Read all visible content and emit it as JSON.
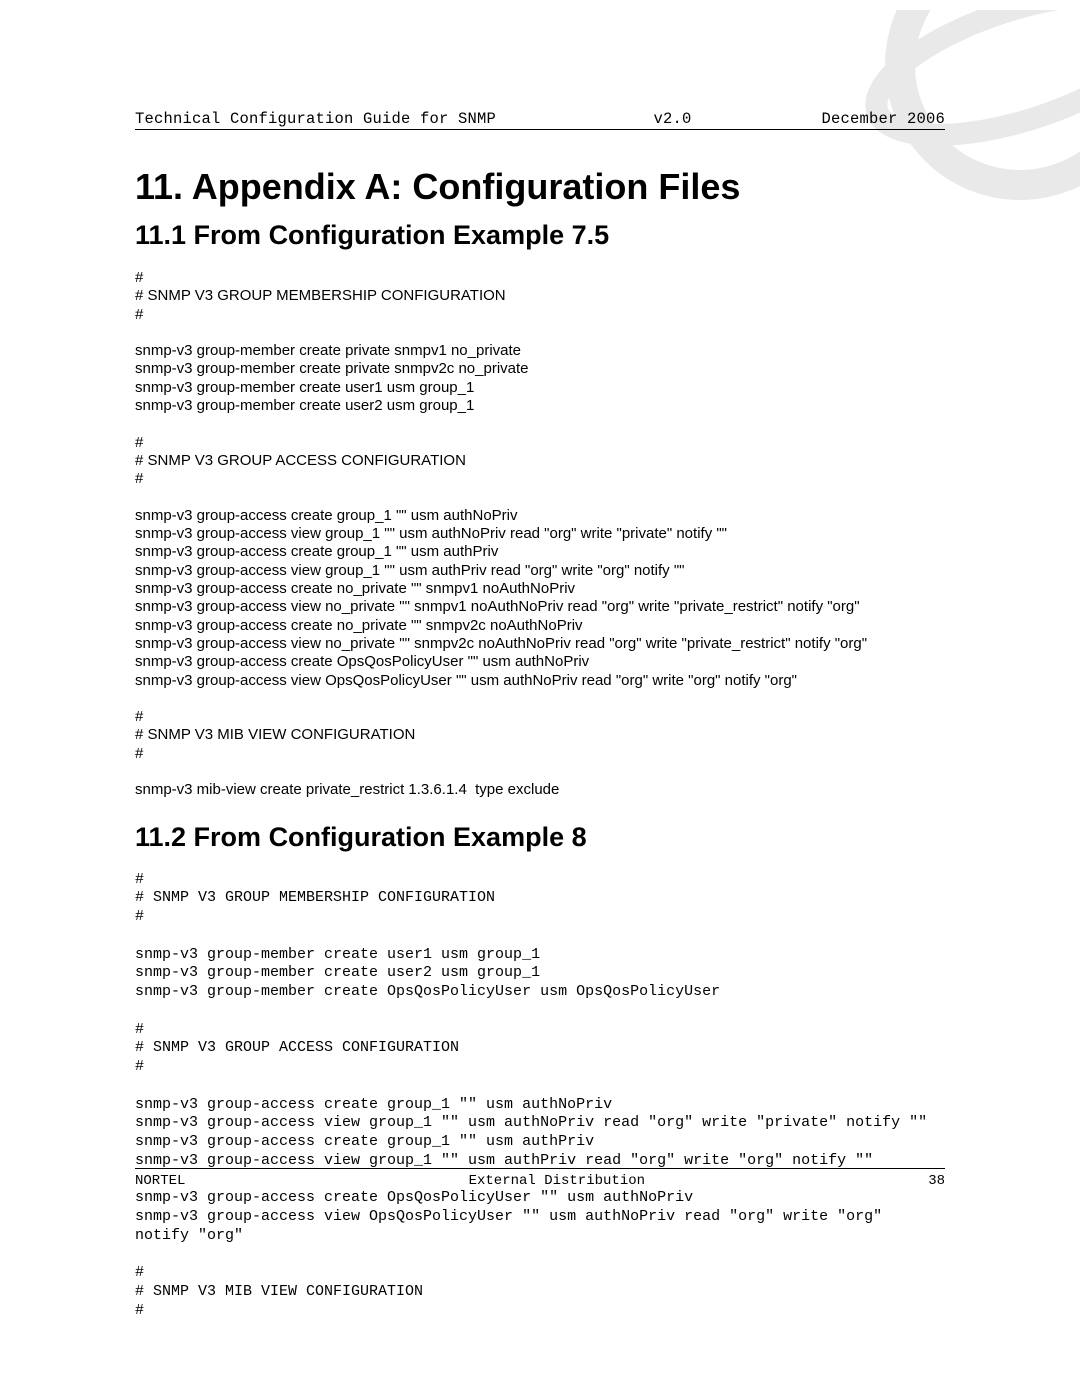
{
  "header": {
    "title_left": "Technical Configuration Guide for SNMP",
    "version": "v2.0",
    "date": "December 2006"
  },
  "h1": "11.  Appendix A: Configuration Files",
  "sec1": {
    "title": "11.1 From Configuration Example 7.5",
    "para1": "#\n# SNMP V3 GROUP MEMBERSHIP CONFIGURATION\n#\n\nsnmp-v3 group-member create private snmpv1 no_private\nsnmp-v3 group-member create private snmpv2c no_private\nsnmp-v3 group-member create user1 usm group_1\nsnmp-v3 group-member create user2 usm group_1\n\n#\n# SNMP V3 GROUP ACCESS CONFIGURATION\n#\n\nsnmp-v3 group-access create group_1 \"\" usm authNoPriv\nsnmp-v3 group-access view group_1 \"\" usm authNoPriv read \"org\" write \"private\" notify \"\"\nsnmp-v3 group-access create group_1 \"\" usm authPriv\nsnmp-v3 group-access view group_1 \"\" usm authPriv read \"org\" write \"org\" notify \"\"\nsnmp-v3 group-access create no_private \"\" snmpv1 noAuthNoPriv\nsnmp-v3 group-access view no_private \"\" snmpv1 noAuthNoPriv read \"org\" write \"private_restrict\" notify \"org\"\nsnmp-v3 group-access create no_private \"\" snmpv2c noAuthNoPriv\nsnmp-v3 group-access view no_private \"\" snmpv2c noAuthNoPriv read \"org\" write \"private_restrict\" notify \"org\"\nsnmp-v3 group-access create OpsQosPolicyUser \"\" usm authNoPriv\nsnmp-v3 group-access view OpsQosPolicyUser \"\" usm authNoPriv read \"org\" write \"org\" notify \"org\"\n\n#\n# SNMP V3 MIB VIEW CONFIGURATION\n#\n\nsnmp-v3 mib-view create private_restrict 1.3.6.1.4  type exclude"
  },
  "sec2": {
    "title": "11.2 From Configuration Example 8",
    "para1": "#\n# SNMP V3 GROUP MEMBERSHIP CONFIGURATION\n#\n\nsnmp-v3 group-member create user1 usm group_1\nsnmp-v3 group-member create user2 usm group_1\nsnmp-v3 group-member create OpsQosPolicyUser usm OpsQosPolicyUser\n\n#\n# SNMP V3 GROUP ACCESS CONFIGURATION\n#\n\nsnmp-v3 group-access create group_1 \"\" usm authNoPriv\nsnmp-v3 group-access view group_1 \"\" usm authNoPriv read \"org\" write \"private\" notify \"\"\nsnmp-v3 group-access create group_1 \"\" usm authPriv\nsnmp-v3 group-access view group_1 \"\" usm authPriv read \"org\" write \"org\" notify \"\"\n\nsnmp-v3 group-access create OpsQosPolicyUser \"\" usm authNoPriv\nsnmp-v3 group-access view OpsQosPolicyUser \"\" usm authNoPriv read \"org\" write \"org\" notify \"org\"\n\n#\n# SNMP V3 MIB VIEW CONFIGURATION\n#"
  },
  "footer": {
    "left": "NORTEL",
    "mid": "External Distribution",
    "page": "38"
  }
}
